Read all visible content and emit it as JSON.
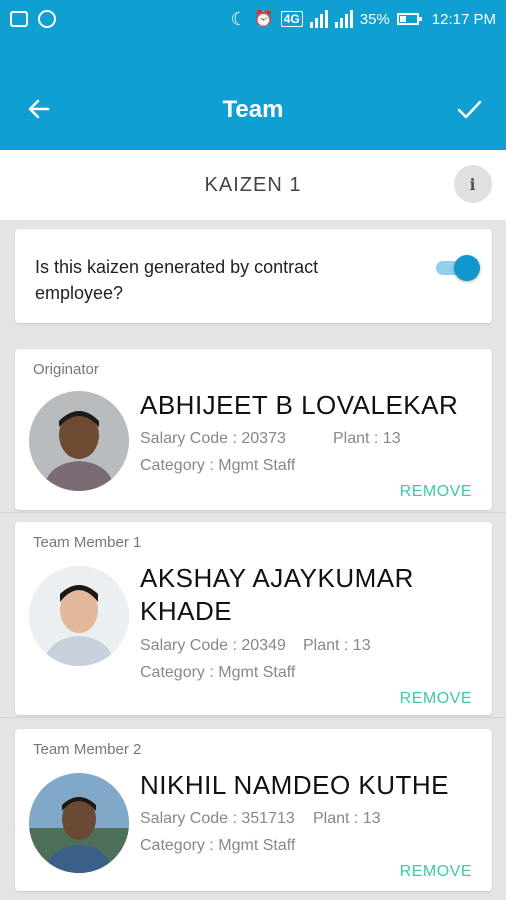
{
  "status_bar": {
    "battery": "35%",
    "time": "12:17 PM",
    "network": "4G"
  },
  "app_bar": {
    "title": "Team",
    "back_icon": "arrow-left-icon",
    "done_icon": "check-icon"
  },
  "subheader": {
    "title": "KAIZEN 1",
    "info_label": "i"
  },
  "contract_toggle": {
    "question": "Is this kaizen generated by contract employee?",
    "enabled": true
  },
  "members": [
    {
      "role": "Originator",
      "name": "ABHIJEET B LOVALEKAR",
      "salary": "Salary Code : 20373",
      "plant": "Plant : 13",
      "category": "Category : Mgmt Staff",
      "remove_label": "REMOVE"
    },
    {
      "role": "Team Member 1",
      "name": "AKSHAY AJAYKUMAR KHADE",
      "salary": "Salary Code : 20349",
      "plant": "Plant : 13",
      "category": "Category : Mgmt Staff",
      "remove_label": "REMOVE"
    },
    {
      "role": "Team Member 2",
      "name": "NIKHIL NAMDEO KUTHE",
      "salary": "Salary Code : 351713",
      "plant": "Plant : 13",
      "category": "Category : Mgmt Staff",
      "remove_label": "REMOVE"
    }
  ],
  "colors": {
    "primary": "#0f9fd1",
    "accent": "#3cc9a8",
    "toggle_on": "#1297cc"
  }
}
